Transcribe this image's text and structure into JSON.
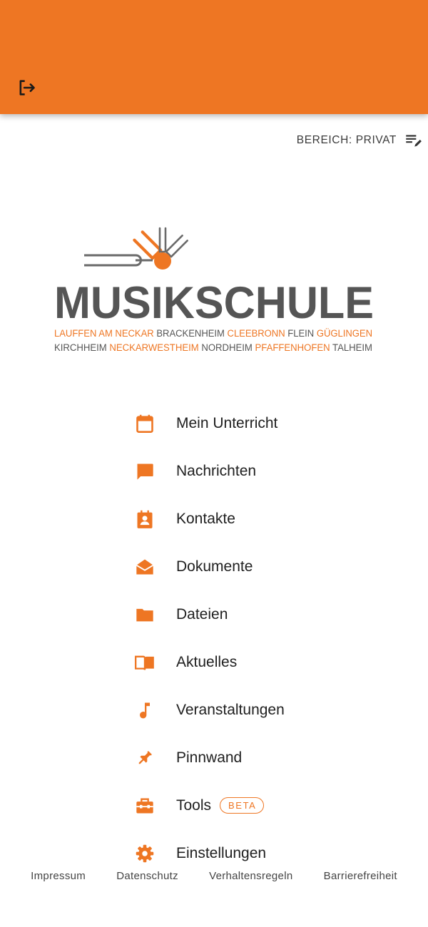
{
  "appbar": {
    "logout_icon": "logout-icon",
    "accent_color": "#ee7623"
  },
  "area": {
    "label": "BEREICH: PRIVAT",
    "icon": "edit-list-icon"
  },
  "logo": {
    "title": "MUSIKSCHULE",
    "line1": [
      {
        "text": "LAUFFEN AM NECKAR",
        "color": "#ee7623"
      },
      {
        "text": "BRACKENHEIM",
        "color": "#555555"
      },
      {
        "text": "CLEEBRONN",
        "color": "#ee7623"
      },
      {
        "text": "FLEIN",
        "color": "#555555"
      },
      {
        "text": "GÜGLINGEN",
        "color": "#ee7623"
      }
    ],
    "line2": [
      {
        "text": "KIRCHHEIM",
        "color": "#555555"
      },
      {
        "text": "NECKARWESTHEIM",
        "color": "#ee7623"
      },
      {
        "text": "NORDHEIM",
        "color": "#555555"
      },
      {
        "text": "PFAFFENHOFEN",
        "color": "#ee7623"
      },
      {
        "text": "TALHEIM",
        "color": "#555555"
      }
    ]
  },
  "menu": [
    {
      "label": "Mein Unterricht",
      "icon": "calendar-icon"
    },
    {
      "label": "Nachrichten",
      "icon": "chat-icon"
    },
    {
      "label": "Kontakte",
      "icon": "contacts-icon"
    },
    {
      "label": "Dokumente",
      "icon": "envelope-open-icon"
    },
    {
      "label": "Dateien",
      "icon": "folder-icon"
    },
    {
      "label": "Aktuelles",
      "icon": "book-icon"
    },
    {
      "label": "Veranstaltungen",
      "icon": "music-note-icon"
    },
    {
      "label": "Pinnwand",
      "icon": "pushpin-icon"
    },
    {
      "label": "Tools",
      "icon": "toolbox-icon",
      "badge": "BETA"
    },
    {
      "label": "Einstellungen",
      "icon": "gear-icon"
    }
  ],
  "footer": [
    "Impressum",
    "Datenschutz",
    "Verhaltensregeln",
    "Barrierefreiheit"
  ]
}
